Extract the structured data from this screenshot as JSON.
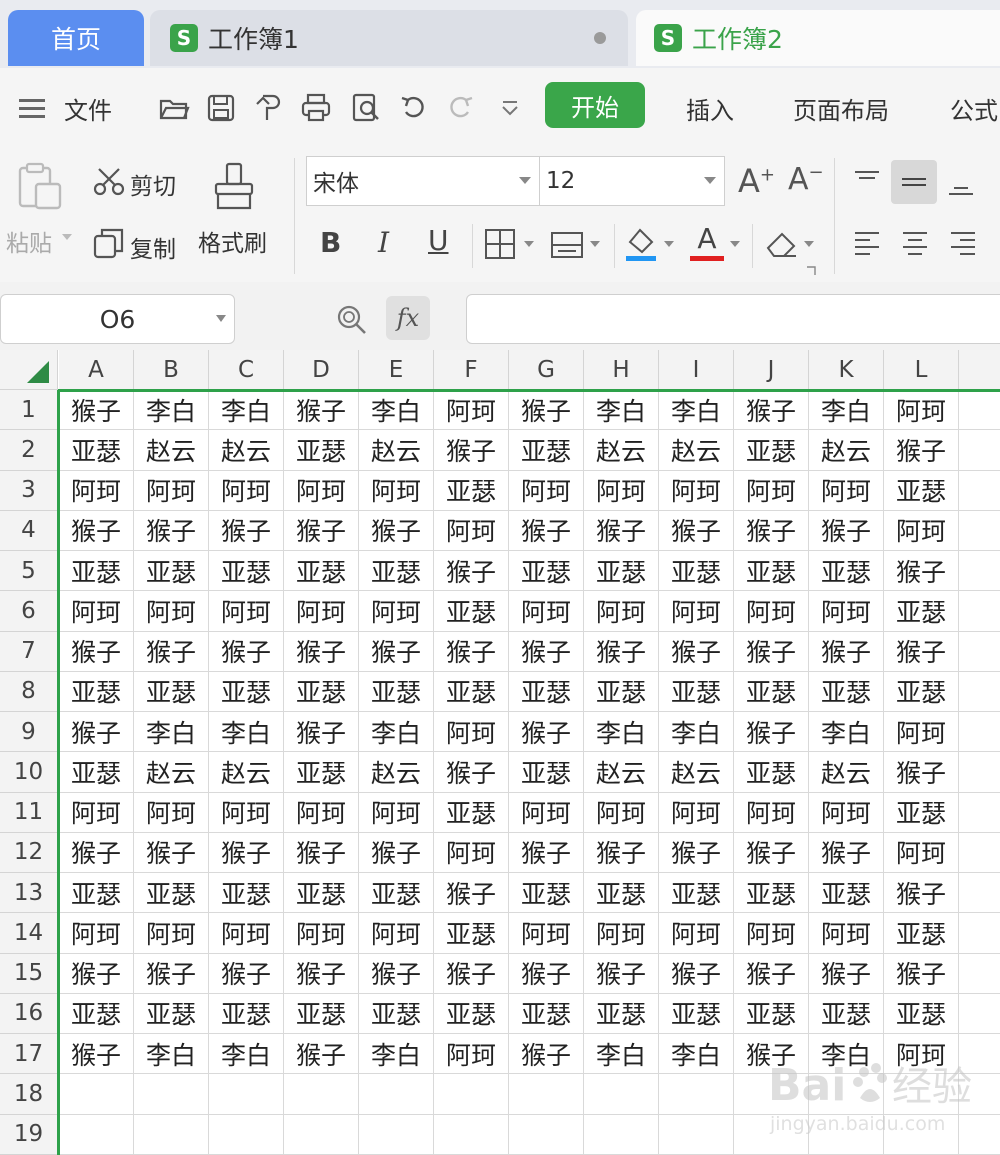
{
  "tabs": {
    "home": "首页",
    "book1": "工作簿1",
    "book2": "工作簿2",
    "sheet_icon_letter": "S"
  },
  "menu": {
    "file": "文件",
    "start": "开始",
    "insert": "插入",
    "page_layout": "页面布局",
    "formula": "公式"
  },
  "ribbon": {
    "paste": "粘贴",
    "cut": "剪切",
    "copy": "复制",
    "format_painter": "格式刷",
    "font_name": "宋体",
    "font_size": "12",
    "bold": "B",
    "italic": "I",
    "underline": "U",
    "font_increase": "A",
    "font_decrease": "A",
    "font_color_letter": "A"
  },
  "formula_bar": {
    "name_box": "O6",
    "fx": "fx",
    "content": ""
  },
  "grid": {
    "columns": [
      "A",
      "B",
      "C",
      "D",
      "E",
      "F",
      "G",
      "H",
      "I",
      "J",
      "K",
      "L"
    ],
    "row_numbers": [
      "1",
      "2",
      "3",
      "4",
      "5",
      "6",
      "7",
      "8",
      "9",
      "10",
      "11",
      "12",
      "13",
      "14",
      "15",
      "16",
      "17",
      "18",
      "19"
    ],
    "rows": [
      [
        "猴子",
        "李白",
        "李白",
        "猴子",
        "李白",
        "阿珂",
        "猴子",
        "李白",
        "李白",
        "猴子",
        "李白",
        "阿珂"
      ],
      [
        "亚瑟",
        "赵云",
        "赵云",
        "亚瑟",
        "赵云",
        "猴子",
        "亚瑟",
        "赵云",
        "赵云",
        "亚瑟",
        "赵云",
        "猴子"
      ],
      [
        "阿珂",
        "阿珂",
        "阿珂",
        "阿珂",
        "阿珂",
        "亚瑟",
        "阿珂",
        "阿珂",
        "阿珂",
        "阿珂",
        "阿珂",
        "亚瑟"
      ],
      [
        "猴子",
        "猴子",
        "猴子",
        "猴子",
        "猴子",
        "阿珂",
        "猴子",
        "猴子",
        "猴子",
        "猴子",
        "猴子",
        "阿珂"
      ],
      [
        "亚瑟",
        "亚瑟",
        "亚瑟",
        "亚瑟",
        "亚瑟",
        "猴子",
        "亚瑟",
        "亚瑟",
        "亚瑟",
        "亚瑟",
        "亚瑟",
        "猴子"
      ],
      [
        "阿珂",
        "阿珂",
        "阿珂",
        "阿珂",
        "阿珂",
        "亚瑟",
        "阿珂",
        "阿珂",
        "阿珂",
        "阿珂",
        "阿珂",
        "亚瑟"
      ],
      [
        "猴子",
        "猴子",
        "猴子",
        "猴子",
        "猴子",
        "猴子",
        "猴子",
        "猴子",
        "猴子",
        "猴子",
        "猴子",
        "猴子"
      ],
      [
        "亚瑟",
        "亚瑟",
        "亚瑟",
        "亚瑟",
        "亚瑟",
        "亚瑟",
        "亚瑟",
        "亚瑟",
        "亚瑟",
        "亚瑟",
        "亚瑟",
        "亚瑟"
      ],
      [
        "猴子",
        "李白",
        "李白",
        "猴子",
        "李白",
        "阿珂",
        "猴子",
        "李白",
        "李白",
        "猴子",
        "李白",
        "阿珂"
      ],
      [
        "亚瑟",
        "赵云",
        "赵云",
        "亚瑟",
        "赵云",
        "猴子",
        "亚瑟",
        "赵云",
        "赵云",
        "亚瑟",
        "赵云",
        "猴子"
      ],
      [
        "阿珂",
        "阿珂",
        "阿珂",
        "阿珂",
        "阿珂",
        "亚瑟",
        "阿珂",
        "阿珂",
        "阿珂",
        "阿珂",
        "阿珂",
        "亚瑟"
      ],
      [
        "猴子",
        "猴子",
        "猴子",
        "猴子",
        "猴子",
        "阿珂",
        "猴子",
        "猴子",
        "猴子",
        "猴子",
        "猴子",
        "阿珂"
      ],
      [
        "亚瑟",
        "亚瑟",
        "亚瑟",
        "亚瑟",
        "亚瑟",
        "猴子",
        "亚瑟",
        "亚瑟",
        "亚瑟",
        "亚瑟",
        "亚瑟",
        "猴子"
      ],
      [
        "阿珂",
        "阿珂",
        "阿珂",
        "阿珂",
        "阿珂",
        "亚瑟",
        "阿珂",
        "阿珂",
        "阿珂",
        "阿珂",
        "阿珂",
        "亚瑟"
      ],
      [
        "猴子",
        "猴子",
        "猴子",
        "猴子",
        "猴子",
        "猴子",
        "猴子",
        "猴子",
        "猴子",
        "猴子",
        "猴子",
        "猴子"
      ],
      [
        "亚瑟",
        "亚瑟",
        "亚瑟",
        "亚瑟",
        "亚瑟",
        "亚瑟",
        "亚瑟",
        "亚瑟",
        "亚瑟",
        "亚瑟",
        "亚瑟",
        "亚瑟"
      ],
      [
        "猴子",
        "李白",
        "李白",
        "猴子",
        "李白",
        "阿珂",
        "猴子",
        "李白",
        "李白",
        "猴子",
        "李白",
        "阿珂"
      ],
      [
        "",
        "",
        "",
        "",
        "",
        "",
        "",
        "",
        "",
        "",
        "",
        ""
      ],
      [
        "",
        "",
        "",
        "",
        "",
        "",
        "",
        "",
        "",
        "",
        "",
        ""
      ]
    ]
  },
  "watermark": {
    "brand": "Baidu经验",
    "url": "jingyan.baidu.com"
  },
  "colors": {
    "accent_green": "#3aa64a",
    "home_tab_blue": "#5b8ef0",
    "selection_green": "#2ea14a"
  },
  "icons": [
    "menu-icon",
    "open-folder-icon",
    "save-icon",
    "export-icon",
    "print-icon",
    "print-preview-icon",
    "undo-icon",
    "redo-icon",
    "more-dropdown-icon",
    "paste-icon",
    "scissors-icon",
    "copy-icon",
    "format-painter-icon",
    "border-icon",
    "cell-style-icon",
    "fill-color-icon",
    "font-color-icon",
    "eraser-icon",
    "align-top-icon",
    "align-middle-icon",
    "align-bottom-icon",
    "align-left-icon",
    "align-center-icon",
    "align-right-icon",
    "zoom-search-icon",
    "select-all-triangle-icon"
  ]
}
